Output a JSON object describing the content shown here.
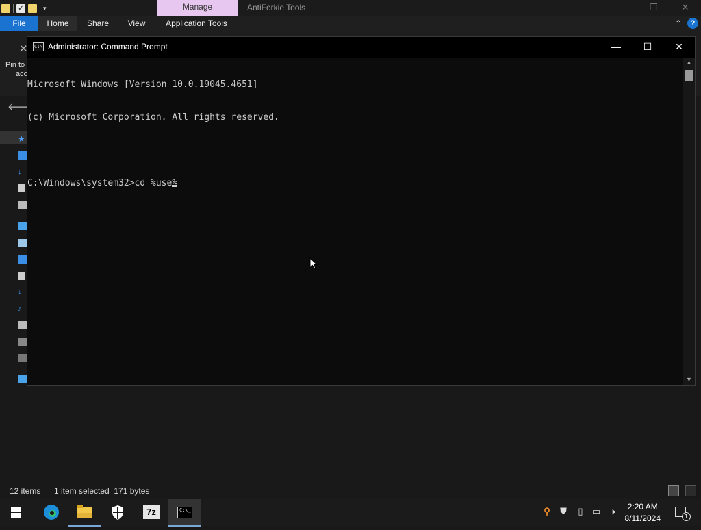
{
  "explorer": {
    "contextual_tab": "Manage",
    "window_title": "AntiForkie Tools",
    "ribbon_tabs": [
      "File",
      "Home",
      "Share",
      "View",
      "Application Tools"
    ],
    "pin_label_line1": "Pin to",
    "pin_label_line2": "acc",
    "status": {
      "items": "12 items",
      "selection": "1 item selected  171 bytes"
    },
    "colors": {
      "file_tab": "#1a73d0",
      "manage_tab": "#e7c7ef"
    }
  },
  "cmd": {
    "title": "Administrator: Command Prompt",
    "icon": "cmd-icon",
    "lines": [
      "Microsoft Windows [Version 10.0.19045.4651]",
      "(c) Microsoft Corporation. All rights reserved.",
      "",
      "C:\\Windows\\system32>cd %use%"
    ]
  },
  "taskbar": {
    "apps": [
      "start-icon",
      "edge-icon",
      "file-explorer-icon",
      "security-icon",
      "7zip-icon",
      "cmd-icon"
    ],
    "sevenzip_label": "7z",
    "time": "2:20 AM",
    "date": "8/11/2024",
    "notification_count": "1"
  }
}
